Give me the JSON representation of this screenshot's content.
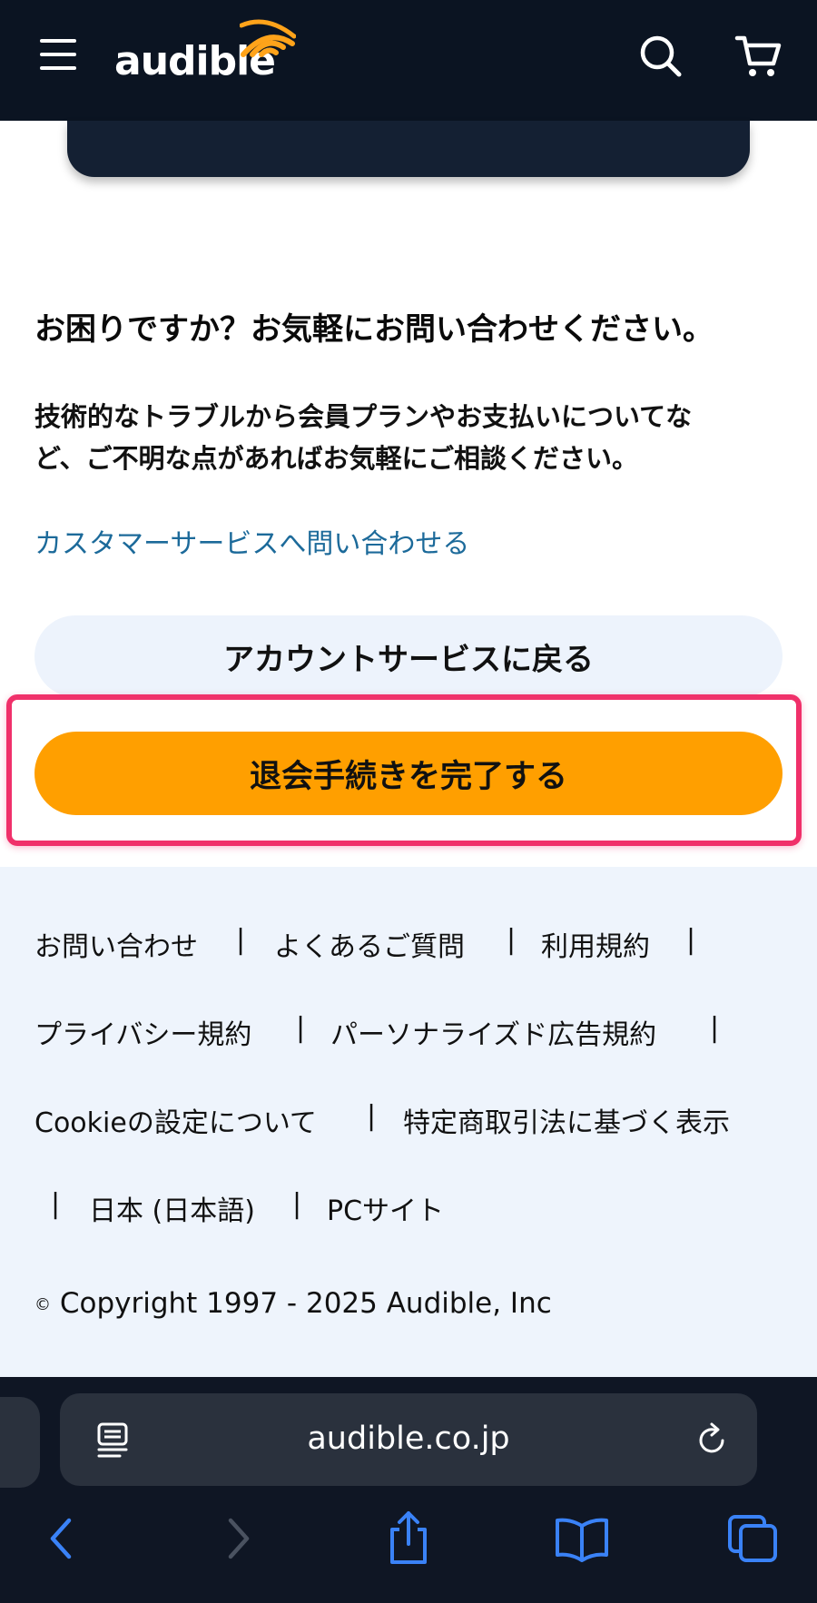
{
  "header": {
    "logo_text": "audible",
    "menu_icon": "hamburger-menu-icon",
    "search_icon": "search-icon",
    "cart_icon": "cart-icon",
    "background": "#0b1422"
  },
  "help": {
    "title": "お困りですか？お気軽にお問い合わせください。",
    "body_line1": "技術的なトラブルから会員プランやお支払いについてな",
    "body_line2": "ど、ご不明な点があればお気軽にご相談ください。",
    "link": "カスタマーサービスへ問い合わせる"
  },
  "buttons": {
    "back": "アカウントサービスに戻る",
    "cancel": "退会手続きを完了する",
    "cancel_color": "#ff9f00",
    "highlight_color": "#f0306a"
  },
  "footer": {
    "links": [
      "お問い合わせ",
      "よくあるご質問",
      "利用規約",
      "プライバシー規約",
      "パーソナライズド広告規約",
      "Cookieの設定について",
      "特定商取引法に基づく表示",
      "日本 (日本語)",
      "PCサイト"
    ],
    "separator": "|",
    "copyright_symbol": "©",
    "copyright": "Copyright 1997 - 2025 Audible, Inc"
  },
  "browser": {
    "url": "audible.co.jp",
    "reader_icon": "reader-mode-icon",
    "reload_icon": "reload-icon",
    "toolbar_icons": [
      "back-arrow-icon",
      "forward-arrow-icon",
      "share-icon",
      "bookmarks-icon",
      "tabs-icon"
    ],
    "accent": "#3a82f7"
  }
}
